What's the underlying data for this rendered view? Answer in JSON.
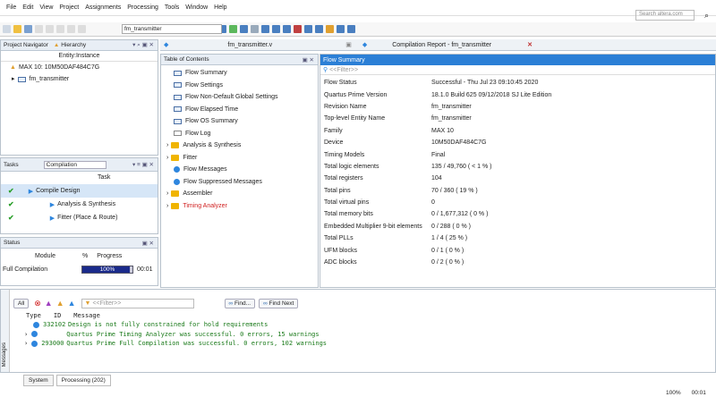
{
  "menu": [
    "File",
    "Edit",
    "View",
    "Project",
    "Assignments",
    "Processing",
    "Tools",
    "Window",
    "Help"
  ],
  "search_placeholder": "Search altera.com",
  "toolbar": {
    "entity": "fm_transmitter"
  },
  "project_navigator": {
    "title": "Project Navigator",
    "view": "Hierarchy",
    "column": "Entity:Instance",
    "device": "MAX 10: 10M50DAF484C7G",
    "top": "fm_transmitter"
  },
  "tasks": {
    "title": "Tasks",
    "flow": "Compilation",
    "column": "Task",
    "items": [
      "Compile Design",
      "Analysis & Synthesis",
      "Fitter (Place & Route)"
    ]
  },
  "status": {
    "title": "Status",
    "col_module": "Module",
    "col_pct": "%",
    "col_progress": "Progress",
    "row_module": "Full Compilation",
    "row_progress": 0.95,
    "row_progress_text": "100%",
    "row_time": "00:01"
  },
  "tabs": {
    "file_tab": "fm_transmitter.v",
    "report_tab": "Compilation Report - fm_transmitter"
  },
  "toc": {
    "title": "Table of Contents",
    "items": [
      "Flow Summary",
      "Flow Settings",
      "Flow Non-Default Global Settings",
      "Flow Elapsed Time",
      "Flow OS Summary",
      "Flow Log",
      "Analysis & Synthesis",
      "Fitter",
      "Flow Messages",
      "Flow Suppressed Messages",
      "Assembler",
      "Timing Analyzer"
    ]
  },
  "summary": {
    "title": "Flow Summary",
    "filter": "<<Filter>>",
    "rows": [
      [
        "Flow Status",
        "Successful - Thu Jul 23 09:10:45 2020"
      ],
      [
        "Quartus Prime Version",
        "18.1.0 Build 625 09/12/2018 SJ Lite Edition"
      ],
      [
        "Revision Name",
        "fm_transmitter"
      ],
      [
        "Top-level Entity Name",
        "fm_transmitter"
      ],
      [
        "Family",
        "MAX 10"
      ],
      [
        "Device",
        "10M50DAF484C7G"
      ],
      [
        "Timing Models",
        "Final"
      ],
      [
        "Total logic elements",
        "135 / 49,760 ( < 1 % )"
      ],
      [
        "Total registers",
        "104"
      ],
      [
        "Total pins",
        "70 / 360 ( 19 % )"
      ],
      [
        "Total virtual pins",
        "0"
      ],
      [
        "Total memory bits",
        "0 / 1,677,312 ( 0 % )"
      ],
      [
        "Embedded Multiplier 9-bit elements",
        "0 / 288 ( 0 % )"
      ],
      [
        "Total PLLs",
        "1 / 4 ( 25 % )"
      ],
      [
        "UFM blocks",
        "0 / 1 ( 0 % )"
      ],
      [
        "ADC blocks",
        "0 / 2 ( 0 % )"
      ]
    ]
  },
  "messages": {
    "all": "All",
    "filter": "<<Filter>>",
    "find": "Find...",
    "find_next": "Find Next",
    "col_type": "Type",
    "col_id": "ID",
    "col_msg": "Message",
    "side_label": "Messages",
    "rows": [
      [
        "332102",
        "Design is not fully constrained for hold requirements"
      ],
      [
        "",
        "Quartus Prime Timing Analyzer was successful. 0 errors, 15 warnings"
      ],
      [
        "293000",
        "Quartus Prime Full Compilation was successful. 0 errors, 102 warnings"
      ]
    ],
    "tab_system": "System",
    "tab_processing": "Processing (202)"
  },
  "statusbar": {
    "pct": "100%",
    "time": "00:01"
  }
}
